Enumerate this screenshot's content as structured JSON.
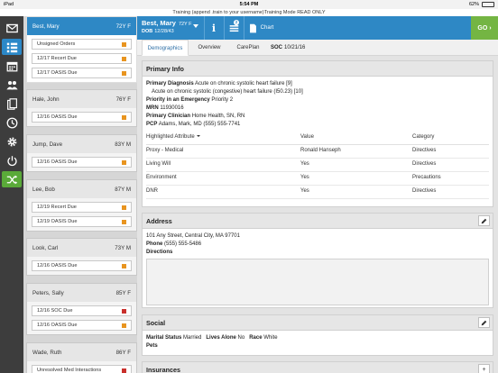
{
  "status_bar": {
    "carrier": "iPad",
    "time": "5:54 PM",
    "battery": "62%"
  },
  "banner": "Training (append .train to your username)Training Mode READ ONLY",
  "rail": {
    "items": [
      {
        "icon": "envelope-icon"
      },
      {
        "icon": "patient-list-icon"
      },
      {
        "icon": "calendar-icon"
      },
      {
        "icon": "people-icon"
      },
      {
        "icon": "documents-icon"
      },
      {
        "icon": "clock-icon"
      },
      {
        "icon": "gear-icon"
      },
      {
        "icon": "power-icon"
      },
      {
        "icon": "shuffle-icon"
      }
    ]
  },
  "patients": [
    {
      "name": "Best, Mary",
      "agesex": "72Y F",
      "selected": true,
      "tasks": [
        {
          "label": "Unsigned Orders",
          "color": "#e8941f"
        },
        {
          "label": "12/17 Recert Due",
          "color": "#e8941f"
        },
        {
          "label": "12/17 OASIS Due",
          "color": "#e8941f"
        }
      ]
    },
    {
      "name": "Hale, John",
      "agesex": "76Y F",
      "tasks": [
        {
          "label": "12/16 OASIS Due",
          "color": "#e8941f"
        }
      ]
    },
    {
      "name": "Jump, Dave",
      "agesex": "83Y M",
      "tasks": [
        {
          "label": "12/16 OASIS Due",
          "color": "#e8941f"
        }
      ]
    },
    {
      "name": "Lee, Bob",
      "agesex": "87Y M",
      "tasks": [
        {
          "label": "12/19 Recert Due",
          "color": "#e8941f"
        },
        {
          "label": "12/19 OASIS Due",
          "color": "#e8941f"
        }
      ]
    },
    {
      "name": "Look, Carl",
      "agesex": "73Y M",
      "tasks": [
        {
          "label": "12/16 OASIS Due",
          "color": "#e8941f"
        }
      ]
    },
    {
      "name": "Peters, Sally",
      "agesex": "85Y F",
      "tasks": [
        {
          "label": "12/16 SOC Due",
          "color": "#c9302c"
        },
        {
          "label": "12/16 OASIS Due",
          "color": "#e8941f"
        }
      ]
    },
    {
      "name": "Wade, Ruth",
      "agesex": "86Y F",
      "tasks": [
        {
          "label": "Unresolved Med Interactions",
          "color": "#c9302c"
        }
      ]
    }
  ],
  "header": {
    "name": "Best, Mary",
    "agesex": "72Y F",
    "dob_label": "DOB",
    "dob": "12/28/43",
    "list_badge": "2",
    "chart_label": "Chart",
    "go_label": "GO"
  },
  "tabs": {
    "items": [
      "Demographics",
      "Overview",
      "CarePlan"
    ],
    "active": "Demographics",
    "soc_label": "SOC",
    "soc_date": "10/21/16"
  },
  "primary_info": {
    "title": "Primary Info",
    "diagnosis_label": "Primary Diagnosis",
    "diagnosis": "Acute on chronic systolic heart failure [9]",
    "diagnosis_sub": "Acute on chronic systolic (congestive) heart failure (I50.23) [10]",
    "priority_label": "Priority in an Emergency",
    "priority": "Priority 2",
    "mrn_label": "MRN",
    "mrn": "11930016",
    "clinician_label": "Primary Clinician",
    "clinician": "Home Health, SN, RN",
    "pcp_label": "PCP",
    "pcp": "Adams, Mark, MD (555) 555-7741",
    "table": {
      "headers": [
        "Highlighted Attribute",
        "Value",
        "Category"
      ],
      "rows": [
        [
          "Proxy - Medical",
          "Ronald Hanseph",
          "Directives"
        ],
        [
          "Living Will",
          "Yes",
          "Directives"
        ],
        [
          "Environment",
          "Yes",
          "Precautions"
        ],
        [
          "DNR",
          "Yes",
          "Directives"
        ]
      ]
    }
  },
  "address": {
    "title": "Address",
    "line": "101 Any Street, Central City, MA 97701",
    "phone_label": "Phone",
    "phone": "(555) 555-5486",
    "directions_label": "Directions",
    "directions": ""
  },
  "social": {
    "title": "Social",
    "marital_label": "Marital Status",
    "marital": "Married",
    "lives_label": "Lives Alone",
    "lives": "No",
    "race_label": "Race",
    "race": "White",
    "pets_label": "Pets",
    "pets": ""
  },
  "insurances": {
    "title": "Insurances"
  }
}
